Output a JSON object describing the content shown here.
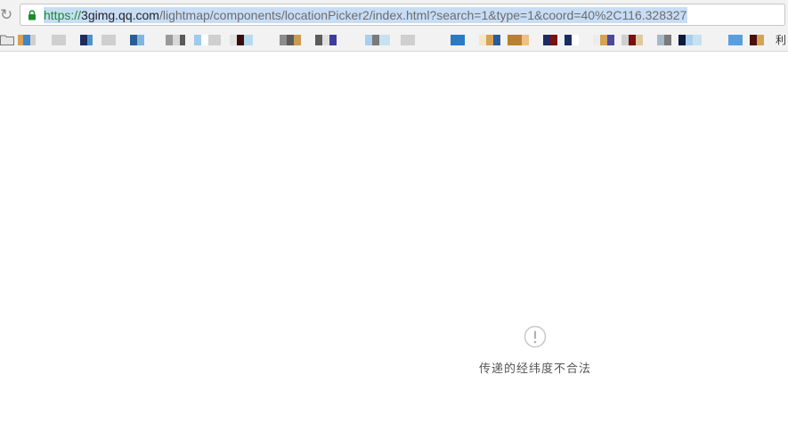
{
  "browser": {
    "reload_icon": "reload-icon",
    "address_bar": {
      "scheme": "https://",
      "host": "3gimg.qq.com",
      "path": "/lightmap/components/locationPicker2/index.html?search=1&type=1&coord=40%2C116.328327",
      "secure_icon": "lock-icon",
      "selected_highlight_color": "#c8ddf5"
    },
    "bookmarks_bar": {
      "folder_icon": "folder-icon",
      "more_label": "利"
    }
  },
  "page": {
    "error_icon": "exclamation-circle-icon",
    "error_message": "传递的经纬度不合法"
  }
}
